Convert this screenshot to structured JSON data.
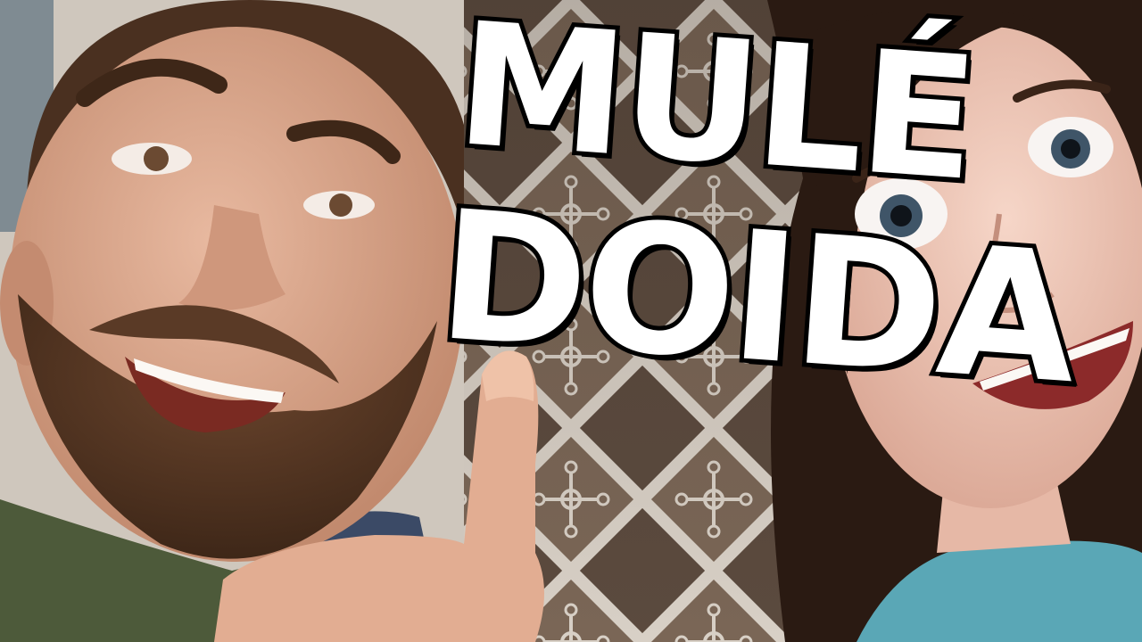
{
  "thumbnail": {
    "title_line1": "MULÉ",
    "title_line2": "DOIDA"
  },
  "colors": {
    "title_fill": "#ffffff",
    "title_stroke": "#000000",
    "pattern_light": "#c9c1b8",
    "pattern_dark": "#3a2d24",
    "skin_man": "#d6a48a",
    "beard": "#5a3a26",
    "shirt_man": "#4d5a3a",
    "hair_woman": "#2a1a12",
    "skin_woman": "#f0c8b8",
    "shirt_woman": "#5aa7b6"
  }
}
